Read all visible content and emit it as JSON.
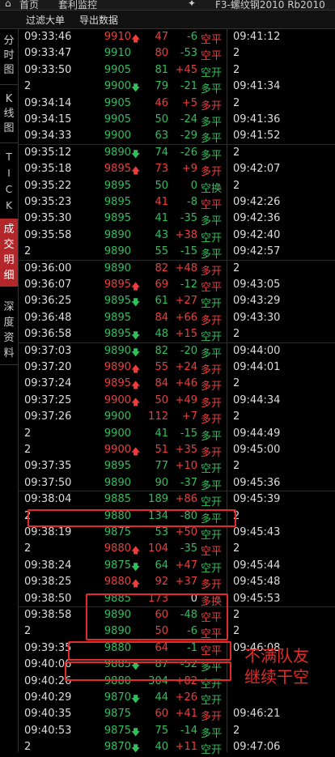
{
  "topbar": {
    "home": "首页",
    "tab": "套利监控",
    "instrument": "F3-螺纹钢2010 Rb2010"
  },
  "toolbar": {
    "filter_label": "过滤大单",
    "export_label": "导出数据"
  },
  "sidebar": [
    "分时图",
    "K线图",
    "TICK",
    "成交明细",
    "深度资料"
  ],
  "annotation": {
    "line1": "不满队友",
    "line2": "继续干空"
  },
  "colors": {
    "up": "#f03c3c",
    "down": "#2ec05b",
    "highlight": "#e32a2a"
  },
  "rows": [
    {
      "time": "09:33:46",
      "price": "9910",
      "arrow": "up",
      "vol": "47",
      "chg": "-6",
      "type": "空平",
      "pc": "r",
      "vc": "r",
      "cc": "g",
      "tc": "r",
      "r2": "09:41:12"
    },
    {
      "time": "09:33:47",
      "price": "9910",
      "arrow": "",
      "vol": "80",
      "chg": "-53",
      "type": "空平",
      "pc": "g",
      "vc": "r",
      "cc": "g",
      "tc": "r",
      "r2": "2"
    },
    {
      "time": "09:33:50",
      "price": "9905",
      "arrow": "",
      "vol": "81",
      "chg": "+45",
      "type": "空开",
      "pc": "g",
      "vc": "g",
      "cc": "r",
      "tc": "g",
      "r2": "2"
    },
    {
      "time": "2",
      "price": "9900",
      "arrow": "down",
      "vol": "79",
      "chg": "-21",
      "type": "多平",
      "pc": "g",
      "vc": "g",
      "cc": "g",
      "tc": "g",
      "r2": "09:41:34"
    },
    {
      "time": "09:34:14",
      "price": "9905",
      "arrow": "",
      "vol": "46",
      "chg": "+5",
      "type": "多开",
      "pc": "g",
      "vc": "r",
      "cc": "r",
      "tc": "r",
      "r2": "2"
    },
    {
      "time": "09:34:15",
      "price": "9905",
      "arrow": "",
      "vol": "50",
      "chg": "-24",
      "type": "多平",
      "pc": "g",
      "vc": "g",
      "cc": "g",
      "tc": "g",
      "r2": "09:41:36"
    },
    {
      "time": "09:34:33",
      "price": "9900",
      "arrow": "",
      "vol": "63",
      "chg": "-29",
      "type": "多平",
      "pc": "g",
      "vc": "g",
      "cc": "g",
      "tc": "g",
      "r2": "09:41:52"
    },
    {
      "time": "09:35:12",
      "price": "9890",
      "arrow": "down",
      "vol": "74",
      "chg": "-26",
      "type": "多平",
      "pc": "g",
      "vc": "g",
      "cc": "g",
      "tc": "g",
      "r2": "2"
    },
    {
      "time": "09:35:18",
      "price": "9895",
      "arrow": "up",
      "vol": "73",
      "chg": "+9",
      "type": "多开",
      "pc": "r",
      "vc": "r",
      "cc": "r",
      "tc": "r",
      "r2": "09:42:07"
    },
    {
      "time": "09:35:22",
      "price": "9895",
      "arrow": "",
      "vol": "50",
      "chg": "0",
      "type": "空换",
      "pc": "g",
      "vc": "g",
      "cc": "g",
      "tc": "g",
      "r2": "2"
    },
    {
      "time": "09:35:23",
      "price": "9895",
      "arrow": "",
      "vol": "41",
      "chg": "-8",
      "type": "空平",
      "pc": "g",
      "vc": "r",
      "cc": "g",
      "tc": "r",
      "r2": "09:42:26"
    },
    {
      "time": "09:35:30",
      "price": "9895",
      "arrow": "",
      "vol": "41",
      "chg": "-35",
      "type": "多平",
      "pc": "g",
      "vc": "g",
      "cc": "g",
      "tc": "g",
      "r2": "09:42:36"
    },
    {
      "time": "09:35:58",
      "price": "9890",
      "arrow": "",
      "vol": "43",
      "chg": "+38",
      "type": "空开",
      "pc": "g",
      "vc": "g",
      "cc": "r",
      "tc": "g",
      "r2": "09:42:40"
    },
    {
      "time": "2",
      "price": "9890",
      "arrow": "",
      "vol": "55",
      "chg": "-15",
      "type": "多平",
      "pc": "g",
      "vc": "g",
      "cc": "g",
      "tc": "g",
      "r2": "09:42:57"
    },
    {
      "time": "09:36:00",
      "price": "9890",
      "arrow": "",
      "vol": "82",
      "chg": "+48",
      "type": "多开",
      "pc": "g",
      "vc": "r",
      "cc": "r",
      "tc": "r",
      "r2": "2"
    },
    {
      "time": "09:36:07",
      "price": "9895",
      "arrow": "up",
      "vol": "69",
      "chg": "-12",
      "type": "空平",
      "pc": "r",
      "vc": "r",
      "cc": "g",
      "tc": "r",
      "r2": "09:43:05"
    },
    {
      "time": "09:36:25",
      "price": "9895",
      "arrow": "down",
      "vol": "61",
      "chg": "+27",
      "type": "空开",
      "pc": "g",
      "vc": "g",
      "cc": "r",
      "tc": "g",
      "r2": "09:43:29"
    },
    {
      "time": "09:36:48",
      "price": "9895",
      "arrow": "",
      "vol": "84",
      "chg": "+66",
      "type": "多开",
      "pc": "g",
      "vc": "r",
      "cc": "r",
      "tc": "r",
      "r2": "09:43:30"
    },
    {
      "time": "09:36:58",
      "price": "9895",
      "arrow": "down",
      "vol": "48",
      "chg": "+15",
      "type": "空开",
      "pc": "g",
      "vc": "g",
      "cc": "r",
      "tc": "g",
      "r2": "2"
    },
    {
      "time": "09:37:03",
      "price": "9890",
      "arrow": "down",
      "vol": "82",
      "chg": "-20",
      "type": "多平",
      "pc": "g",
      "vc": "g",
      "cc": "g",
      "tc": "g",
      "r2": "09:44:00"
    },
    {
      "time": "09:37:20",
      "price": "9890",
      "arrow": "up",
      "vol": "55",
      "chg": "+24",
      "type": "多开",
      "pc": "r",
      "vc": "r",
      "cc": "r",
      "tc": "r",
      "r2": "09:44:01"
    },
    {
      "time": "09:37:24",
      "price": "9895",
      "arrow": "up",
      "vol": "84",
      "chg": "+46",
      "type": "多开",
      "pc": "r",
      "vc": "r",
      "cc": "r",
      "tc": "r",
      "r2": "2"
    },
    {
      "time": "09:37:25",
      "price": "9900",
      "arrow": "up",
      "vol": "50",
      "chg": "+49",
      "type": "多开",
      "pc": "r",
      "vc": "r",
      "cc": "r",
      "tc": "r",
      "r2": "09:44:34"
    },
    {
      "time": "09:37:26",
      "price": "9900",
      "arrow": "",
      "vol": "112",
      "chg": "+7",
      "type": "多开",
      "pc": "g",
      "vc": "r",
      "cc": "r",
      "tc": "r",
      "r2": "2"
    },
    {
      "time": "2",
      "price": "9900",
      "arrow": "",
      "vol": "41",
      "chg": "-15",
      "type": "多平",
      "pc": "g",
      "vc": "g",
      "cc": "g",
      "tc": "g",
      "r2": "09:44:49"
    },
    {
      "time": "2",
      "price": "9900",
      "arrow": "up",
      "vol": "51",
      "chg": "+35",
      "type": "多开",
      "pc": "r",
      "vc": "r",
      "cc": "r",
      "tc": "r",
      "r2": "09:45:00"
    },
    {
      "time": "09:37:35",
      "price": "9895",
      "arrow": "",
      "vol": "77",
      "chg": "+10",
      "type": "空开",
      "pc": "g",
      "vc": "g",
      "cc": "r",
      "tc": "g",
      "r2": "2"
    },
    {
      "time": "09:37:50",
      "price": "9890",
      "arrow": "",
      "vol": "90",
      "chg": "-37",
      "type": "多平",
      "pc": "g",
      "vc": "g",
      "cc": "g",
      "tc": "g",
      "r2": "09:45:36"
    },
    {
      "time": "09:38:04",
      "price": "9885",
      "arrow": "",
      "vol": "189",
      "chg": "+86",
      "type": "空开",
      "pc": "g",
      "vc": "g",
      "cc": "r",
      "tc": "g",
      "r2": "09:45:39"
    },
    {
      "time": "2",
      "price": "9880",
      "arrow": "",
      "vol": "134",
      "chg": "-80",
      "type": "多平",
      "pc": "g",
      "vc": "g",
      "cc": "g",
      "tc": "g",
      "r2": "2"
    },
    {
      "time": "09:38:19",
      "price": "9875",
      "arrow": "",
      "vol": "53",
      "chg": "+50",
      "type": "空开",
      "pc": "g",
      "vc": "g",
      "cc": "r",
      "tc": "g",
      "r2": "09:45:43"
    },
    {
      "time": "2",
      "price": "9880",
      "arrow": "up",
      "vol": "104",
      "chg": "-35",
      "type": "空平",
      "pc": "r",
      "vc": "r",
      "cc": "g",
      "tc": "r",
      "r2": "2"
    },
    {
      "time": "09:38:24",
      "price": "9875",
      "arrow": "down",
      "vol": "64",
      "chg": "+47",
      "type": "空开",
      "pc": "g",
      "vc": "g",
      "cc": "r",
      "tc": "g",
      "r2": "09:45:44"
    },
    {
      "time": "09:38:25",
      "price": "9880",
      "arrow": "up",
      "vol": "92",
      "chg": "+37",
      "type": "多开",
      "pc": "r",
      "vc": "r",
      "cc": "r",
      "tc": "r",
      "r2": "09:45:48"
    },
    {
      "time": "09:38:50",
      "price": "9885",
      "arrow": "",
      "vol": "173",
      "chg": "0",
      "type": "多换",
      "pc": "g",
      "vc": "r",
      "cc": "w",
      "tc": "r",
      "r2": "09:45:53"
    },
    {
      "time": "09:38:58",
      "price": "9890",
      "arrow": "",
      "vol": "60",
      "chg": "-48",
      "type": "空平",
      "pc": "g",
      "vc": "r",
      "cc": "g",
      "tc": "r",
      "r2": "2"
    },
    {
      "time": "2",
      "price": "9890",
      "arrow": "",
      "vol": "50",
      "chg": "-6",
      "type": "空平",
      "pc": "g",
      "vc": "r",
      "cc": "g",
      "tc": "r",
      "r2": "2"
    },
    {
      "time": "09:39:35",
      "price": "9880",
      "arrow": "",
      "vol": "64",
      "chg": "-1",
      "type": "空平",
      "pc": "g",
      "vc": "r",
      "cc": "g",
      "tc": "r",
      "r2": "09:46:08"
    },
    {
      "time": "09:40:06",
      "price": "9885",
      "arrow": "down",
      "vol": "87",
      "chg": "-52",
      "type": "多平",
      "pc": "g",
      "vc": "g",
      "cc": "g",
      "tc": "g",
      "r2": ""
    },
    {
      "time": "09:40:26",
      "price": "9880",
      "arrow": "",
      "vol": "304",
      "chg": "+82",
      "type": "空开",
      "pc": "g",
      "vc": "g",
      "cc": "r",
      "tc": "g",
      "r2": ""
    },
    {
      "time": "09:40:29",
      "price": "9870",
      "arrow": "down",
      "vol": "44",
      "chg": "+26",
      "type": "空开",
      "pc": "g",
      "vc": "g",
      "cc": "r",
      "tc": "g",
      "r2": ""
    },
    {
      "time": "09:40:35",
      "price": "9875",
      "arrow": "",
      "vol": "60",
      "chg": "+41",
      "type": "多开",
      "pc": "g",
      "vc": "r",
      "cc": "r",
      "tc": "r",
      "r2": "09:46:21"
    },
    {
      "time": "09:40:53",
      "price": "9875",
      "arrow": "down",
      "vol": "75",
      "chg": "-14",
      "type": "多平",
      "pc": "g",
      "vc": "g",
      "cc": "g",
      "tc": "g",
      "r2": "2"
    },
    {
      "time": "2",
      "price": "9870",
      "arrow": "down",
      "vol": "40",
      "chg": "+11",
      "type": "空开",
      "pc": "g",
      "vc": "g",
      "cc": "r",
      "tc": "g",
      "r2": "09:47:06"
    }
  ]
}
